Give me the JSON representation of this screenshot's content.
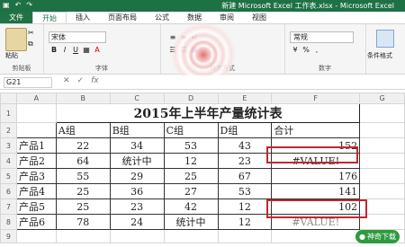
{
  "window": {
    "title": "新建 Microsoft Excel 工作表.xlsx - Microsoft Excel"
  },
  "tabs": [
    "文件",
    "开始",
    "插入",
    "页面布局",
    "公式",
    "数据",
    "审阅",
    "视图"
  ],
  "ribbon": {
    "clipboard_label": "剪贴板",
    "paste_label": "粘贴",
    "font_name": "宋体",
    "font_group_label": "字体",
    "bold": "B",
    "italic": "I",
    "underline": "U",
    "align_group_label": "对齐方式",
    "number_format": "常规",
    "number_group_label": "数字",
    "styles_label": "条件格式"
  },
  "formula_bar": {
    "name_box": "G21",
    "cancel": "✕",
    "confirm": "✓",
    "fx": "fx",
    "content": ""
  },
  "columns": [
    "A",
    "B",
    "C",
    "D",
    "E",
    "F",
    "G"
  ],
  "rows": [
    "1",
    "2",
    "3",
    "4",
    "5",
    "6",
    "7",
    "8",
    "9"
  ],
  "sheet": {
    "title": "2015年上半年产量统计表",
    "headers": [
      "",
      "A组",
      "B组",
      "C组",
      "D组",
      "合计"
    ],
    "data": [
      [
        "产品1",
        "22",
        "34",
        "53",
        "43",
        "152"
      ],
      [
        "产品2",
        "64",
        "统计中",
        "12",
        "23",
        "#VALUE!"
      ],
      [
        "产品3",
        "55",
        "29",
        "25",
        "67",
        "176"
      ],
      [
        "产品4",
        "25",
        "36",
        "27",
        "53",
        "141"
      ],
      [
        "产品5",
        "25",
        "23",
        "42",
        "12",
        "102"
      ],
      [
        "产品6",
        "78",
        "24",
        "统计中",
        "12",
        "#VALUE!"
      ]
    ]
  },
  "watermark": {
    "text": "神奇下载"
  }
}
